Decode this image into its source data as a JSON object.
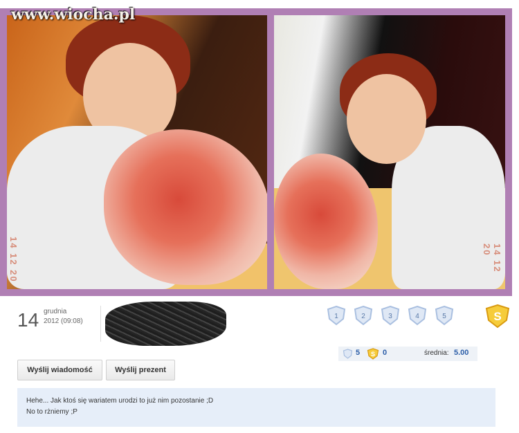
{
  "watermark": "www.wiocha.pl",
  "photos": {
    "left_stamp": "14 12 20",
    "right_stamp": "14 12 20"
  },
  "post": {
    "day": "14",
    "month": "grudnia",
    "time": "2012 (09:08)"
  },
  "rating": {
    "stars": [
      "1",
      "2",
      "3",
      "4",
      "5"
    ],
    "super_icon": "S",
    "votes_count": "5",
    "super_count": "0",
    "average_label": "średnia:",
    "average_value": "5.00",
    "colors": {
      "star": "#a9bfe0",
      "super": "#f2b822",
      "text": "#2c5ea8"
    }
  },
  "actions": {
    "send_message": "Wyślij wiadomość",
    "send_gift": "Wyślij prezent"
  },
  "comment": {
    "line1": "Hehe... Jak ktoś się wariatem urodzi to już nim pozostanie ;D",
    "line2": "No to rżniemy ;P"
  }
}
